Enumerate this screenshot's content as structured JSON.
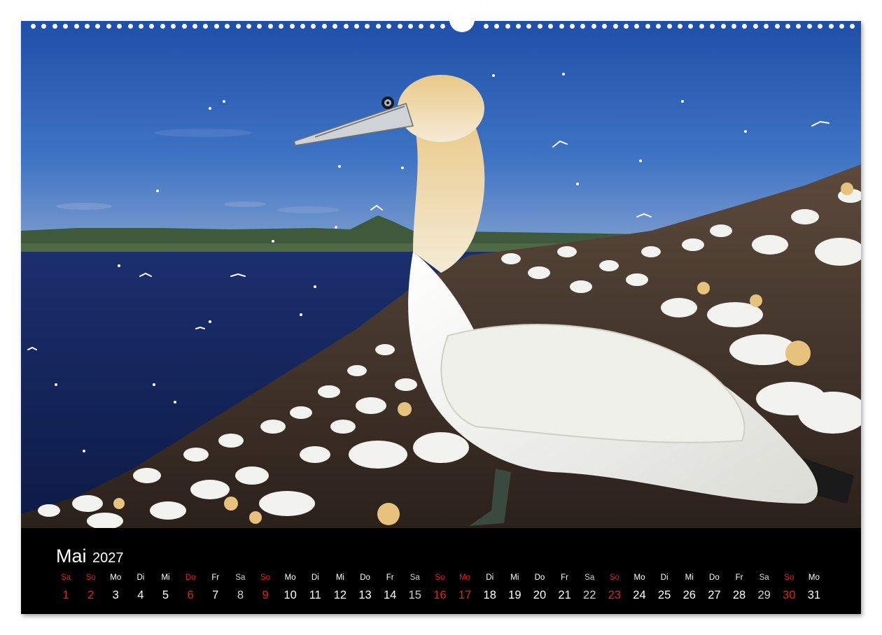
{
  "calendar": {
    "month": "Mai",
    "year": "2027",
    "colors": {
      "holiday": "#e3201b",
      "saturday": "#cfcfcf",
      "weekday": "#ffffff",
      "strip_background": "#000000"
    },
    "days": [
      {
        "name": "Sa",
        "num": "1",
        "type": "holiday"
      },
      {
        "name": "So",
        "num": "2",
        "type": "holiday"
      },
      {
        "name": "Mo",
        "num": "3",
        "type": "weekday"
      },
      {
        "name": "Di",
        "num": "4",
        "type": "weekday"
      },
      {
        "name": "Mi",
        "num": "5",
        "type": "weekday"
      },
      {
        "name": "Do",
        "num": "6",
        "type": "holiday"
      },
      {
        "name": "Fr",
        "num": "7",
        "type": "weekday"
      },
      {
        "name": "Sa",
        "num": "8",
        "type": "saturday"
      },
      {
        "name": "So",
        "num": "9",
        "type": "holiday"
      },
      {
        "name": "Mo",
        "num": "10",
        "type": "weekday"
      },
      {
        "name": "Di",
        "num": "11",
        "type": "weekday"
      },
      {
        "name": "Mi",
        "num": "12",
        "type": "weekday"
      },
      {
        "name": "Do",
        "num": "13",
        "type": "weekday"
      },
      {
        "name": "Fr",
        "num": "14",
        "type": "weekday"
      },
      {
        "name": "Sa",
        "num": "15",
        "type": "saturday"
      },
      {
        "name": "So",
        "num": "16",
        "type": "holiday"
      },
      {
        "name": "Mo",
        "num": "17",
        "type": "holiday"
      },
      {
        "name": "Di",
        "num": "18",
        "type": "weekday"
      },
      {
        "name": "Mi",
        "num": "19",
        "type": "weekday"
      },
      {
        "name": "Do",
        "num": "20",
        "type": "weekday"
      },
      {
        "name": "Fr",
        "num": "21",
        "type": "weekday"
      },
      {
        "name": "Sa",
        "num": "22",
        "type": "saturday"
      },
      {
        "name": "So",
        "num": "23",
        "type": "holiday"
      },
      {
        "name": "Mo",
        "num": "24",
        "type": "weekday"
      },
      {
        "name": "Di",
        "num": "25",
        "type": "weekday"
      },
      {
        "name": "Mi",
        "num": "26",
        "type": "weekday"
      },
      {
        "name": "Do",
        "num": "27",
        "type": "weekday"
      },
      {
        "name": "Fr",
        "num": "28",
        "type": "weekday"
      },
      {
        "name": "Sa",
        "num": "29",
        "type": "saturday"
      },
      {
        "name": "So",
        "num": "30",
        "type": "holiday"
      },
      {
        "name": "Mo",
        "num": "31",
        "type": "weekday"
      }
    ]
  }
}
